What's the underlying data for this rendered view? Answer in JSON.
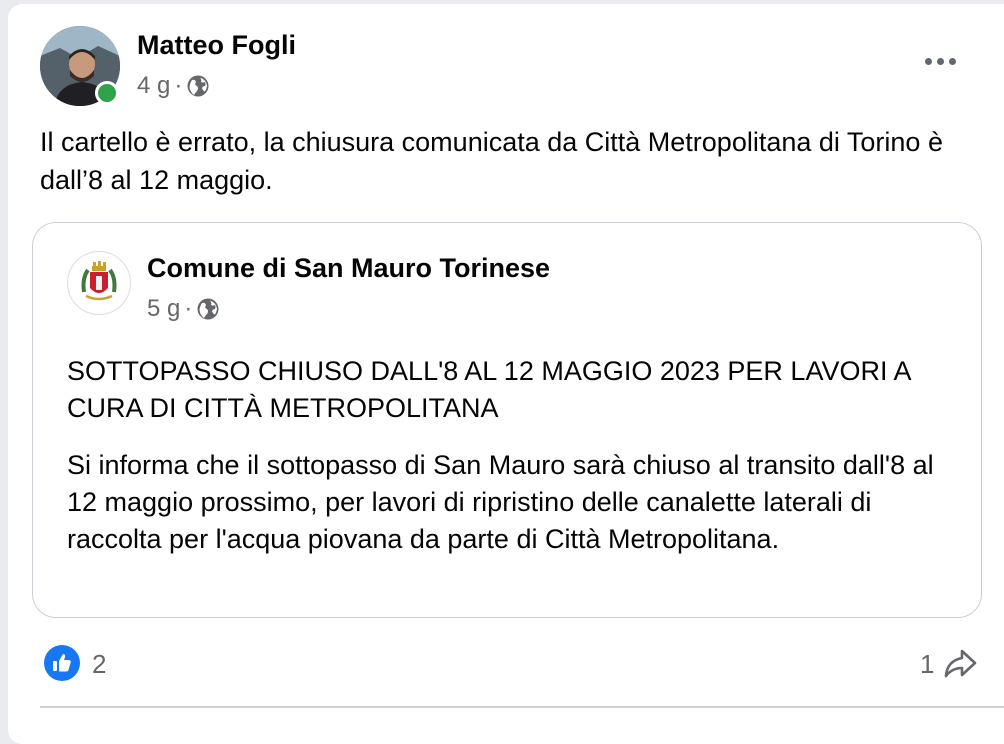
{
  "post": {
    "author": "Matteo Fogli",
    "age": "4 g",
    "separator": "·",
    "privacy_icon": "globe-icon",
    "text": "Il cartello è errato, la chiusura comunicata da Città Metropolitana di Torino è dall’8 al 12 maggio."
  },
  "shared_post": {
    "page_name": "Comune di San Mauro Torinese",
    "age": "5 g",
    "separator": "·",
    "privacy_icon": "globe-icon",
    "title": "SOTTOPASSO CHIUSO DALL'8 AL 12 MAGGIO 2023 PER LAVORI A CURA DI CITTÀ METROPOLITANA",
    "body": "Si informa che il sottopasso di San Mauro sarà chiuso al transito dall'8 al 12 maggio prossimo, per lavori di ripristino delle canalette laterali di raccolta per l'acqua piovana da parte di Città Metropolitana."
  },
  "footer": {
    "like_count": "2",
    "share_count": "1",
    "like_icon": "thumbs-up-icon",
    "share_icon": "share-arrow-icon"
  },
  "colors": {
    "online": "#31a24c",
    "like": "#1877f2",
    "secondary_text": "#65676b"
  }
}
